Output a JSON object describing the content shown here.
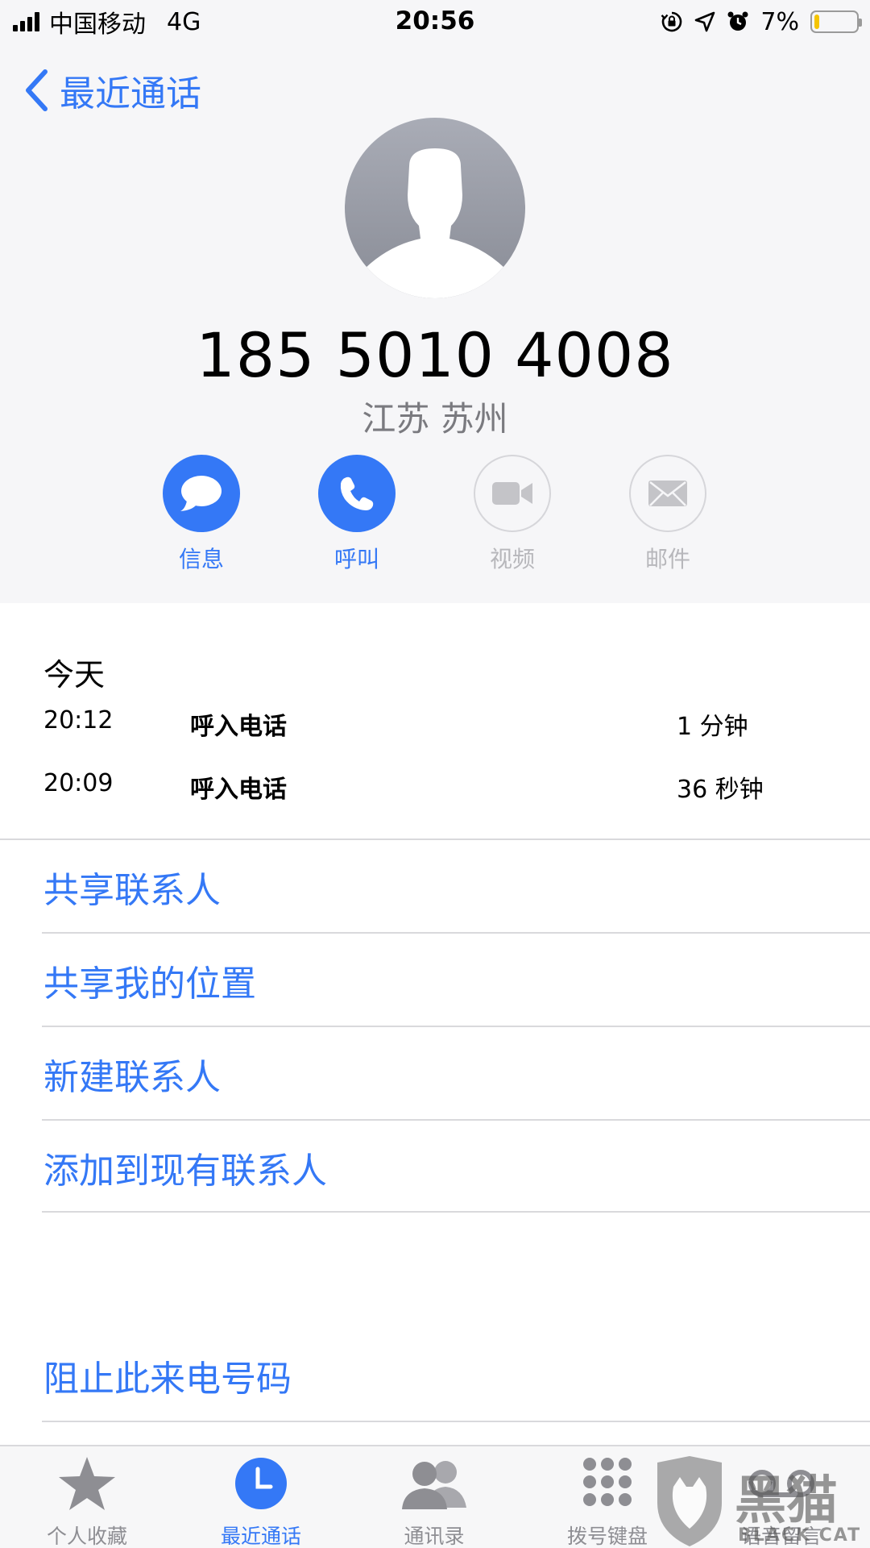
{
  "status_bar": {
    "carrier": "中国移动",
    "network": "4G",
    "time": "20:56",
    "battery_percent": "7%",
    "battery_level": 0.07,
    "icons": [
      "rotation-lock-icon",
      "location-arrow-icon",
      "alarm-icon"
    ]
  },
  "nav": {
    "back_label": "最近通话"
  },
  "contact": {
    "phone_number": "185 5010 4008",
    "location": "江苏 苏州"
  },
  "actions": [
    {
      "label": "信息",
      "icon": "message-bubble-icon",
      "enabled": true
    },
    {
      "label": "呼叫",
      "icon": "phone-icon",
      "enabled": true
    },
    {
      "label": "视频",
      "icon": "video-camera-icon",
      "enabled": false
    },
    {
      "label": "邮件",
      "icon": "envelope-icon",
      "enabled": false
    }
  ],
  "history": {
    "date": "今天",
    "calls": [
      {
        "time": "20:12",
        "kind": "呼入电话",
        "duration": "1 分钟"
      },
      {
        "time": "20:09",
        "kind": "呼入电话",
        "duration": "36 秒钟"
      }
    ]
  },
  "options": [
    {
      "label": "共享联系人"
    },
    {
      "label": "共享我的位置"
    },
    {
      "label": "新建联系人"
    },
    {
      "label": "添加到现有联系人"
    },
    {
      "label": "阻止此来电号码"
    }
  ],
  "tabs": [
    {
      "label": "个人收藏",
      "icon": "star-icon",
      "active": false
    },
    {
      "label": "最近通话",
      "icon": "clock-icon",
      "active": true
    },
    {
      "label": "通讯录",
      "icon": "contacts-icon",
      "active": false
    },
    {
      "label": "拨号键盘",
      "icon": "keypad-icon",
      "active": false
    },
    {
      "label": "语音留言",
      "icon": "voicemail-icon",
      "active": false
    }
  ],
  "watermark": {
    "text": "黑猫",
    "subtext": "BLACK CAT"
  },
  "colors": {
    "accent": "#3478f6",
    "header_bg": "#f6f6f8",
    "secondary_text": "#7a7a7f",
    "disabled": "#b7b7bb",
    "battery_low": "#f5c400"
  }
}
